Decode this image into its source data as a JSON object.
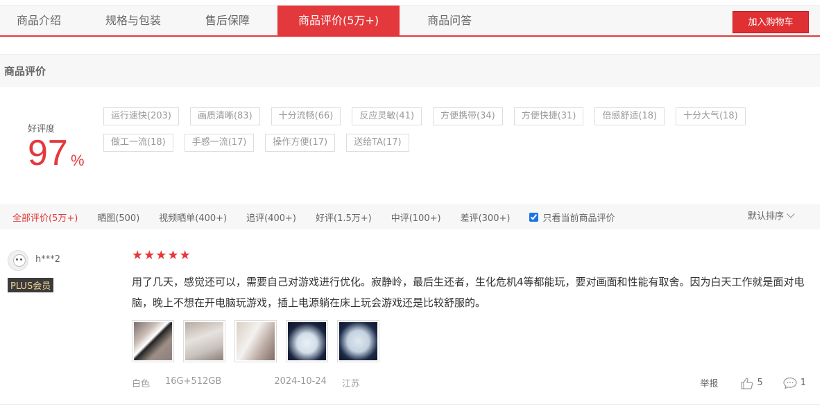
{
  "tabs": [
    {
      "label": "商品介绍"
    },
    {
      "label": "规格与包装"
    },
    {
      "label": "售后保障"
    },
    {
      "label": "商品评价(5万+)"
    },
    {
      "label": "商品问答"
    }
  ],
  "cart_button": "加入购物车",
  "section_title": "商品评价",
  "rating": {
    "label": "好评度",
    "value": "97",
    "unit": "%"
  },
  "tags_row1": [
    "运行速快(203)",
    "画质清晰(83)",
    "十分流畅(66)",
    "反应灵敏(41)",
    "方便携带(34)",
    "方便快捷(31)",
    "倍感舒适(18)",
    "十分大气(18)"
  ],
  "tags_row2": [
    "做工一流(18)",
    "手感一流(17)",
    "操作方便(17)",
    "送给TA(17)"
  ],
  "filters": [
    "全部评价(5万+)",
    "晒图(500)",
    "视频晒单(400+)",
    "追评(400+)",
    "好评(1.5万+)",
    "中评(100+)",
    "差评(300+)"
  ],
  "only_current": "只看当前商品评价",
  "sort_label": "默认排序",
  "review": {
    "username": "h***2",
    "badge": "PLUS会员",
    "stars": 5,
    "content": "用了几天，感觉还可以，需要自己对游戏进行优化。寂静岭，最后生还者，生化危机4等都能玩，要对画面和性能有取舍。因为白天工作就是面对电脑，晚上不想在开电脑玩游戏，插上电源躺在床上玩会游戏还是比较舒服的。",
    "color": "白色",
    "spec": "16G+512GB",
    "date": "2024-10-24",
    "location": "江苏",
    "report": "举报",
    "likes": "5",
    "comments": "1"
  },
  "colors": {
    "accent": "#e4393c",
    "badge_bg": "#3b3b3b",
    "badge_text": "#f5d393"
  }
}
